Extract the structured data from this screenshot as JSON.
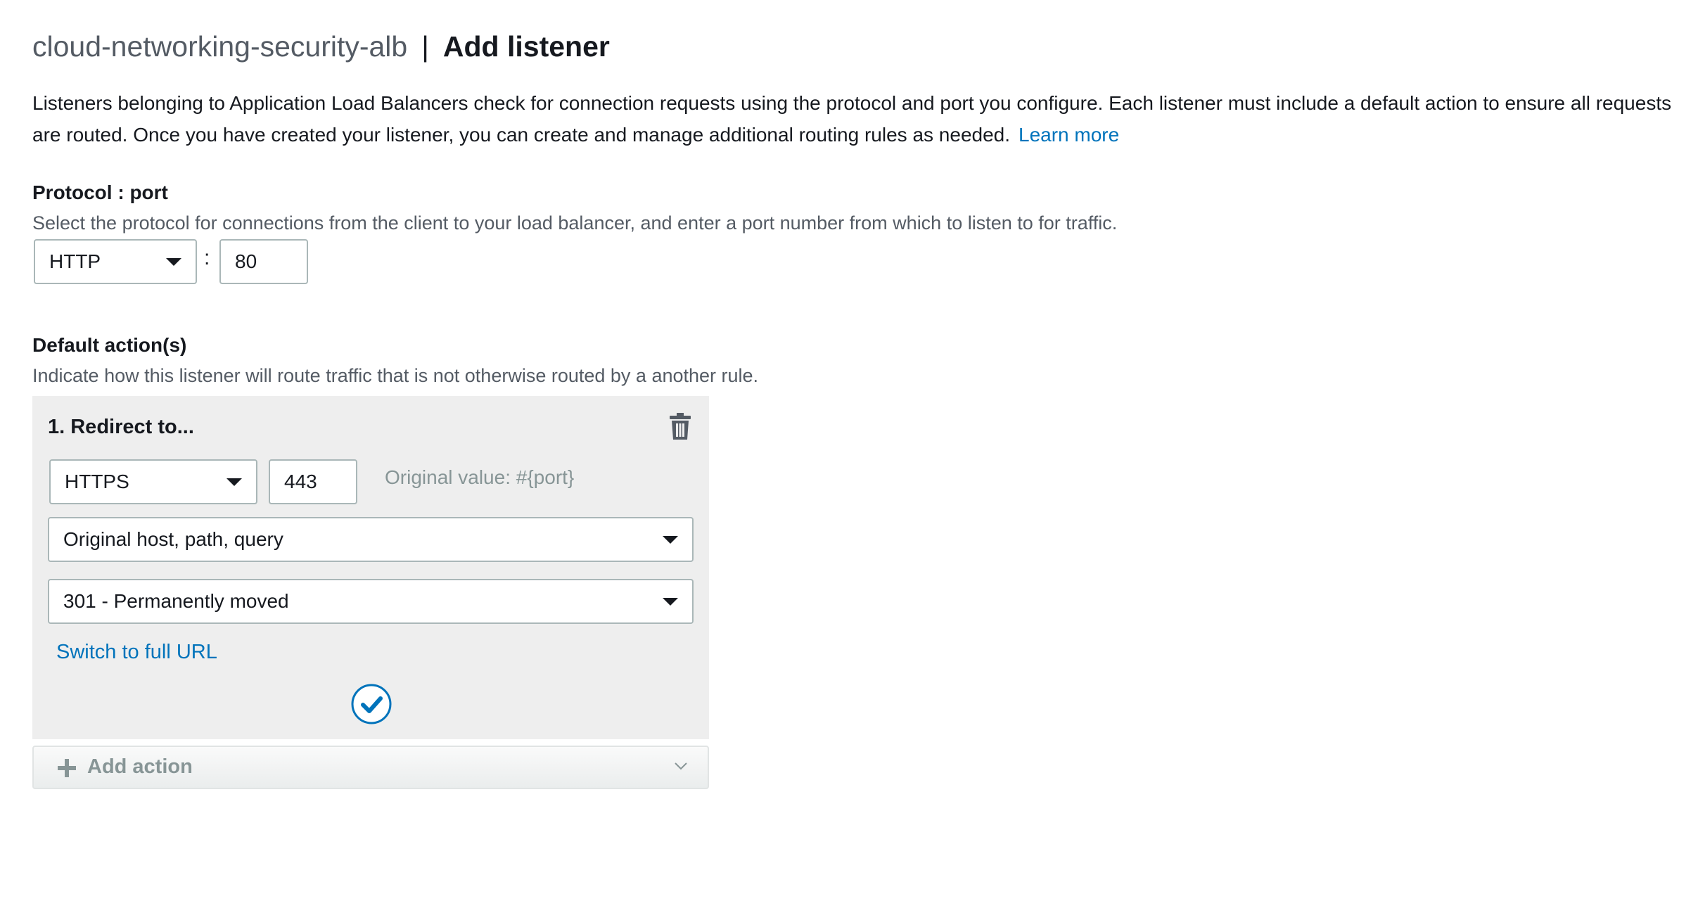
{
  "header": {
    "load_balancer_name": "cloud-networking-security-alb",
    "separator": "|",
    "title": "Add listener"
  },
  "intro": {
    "line1": "Listeners belonging to Application Load Balancers check for connection requests using the protocol and port you configure. Each listener must include a default action to ensure all requests",
    "line2": "are routed. Once you have created your listener, you can create and manage additional routing rules as needed.",
    "learn_more": "Learn more"
  },
  "protocol_port": {
    "label": "Protocol : port",
    "description": "Select the protocol for connections from the client to your load balancer, and enter a port number from which to listen to for traffic.",
    "protocol_value": "HTTP",
    "colon": ":",
    "port_value": "80"
  },
  "default_actions": {
    "label": "Default action(s)",
    "description": "Indicate how this listener will route traffic that is not otherwise routed by a another rule.",
    "action": {
      "title": "1. Redirect to...",
      "protocol_value": "HTTPS",
      "port_value": "443",
      "original_value_hint": "Original value: #{port}",
      "target_value": "Original host, path, query",
      "status_code_value": "301 - Permanently moved",
      "switch_link": "Switch to full URL"
    },
    "add_action_label": "Add action"
  },
  "colors": {
    "link": "#0073bb",
    "panel_bg": "#eeeeee",
    "border": "#aab7b8",
    "muted": "#879596"
  },
  "icons": {
    "trash": "trash-icon",
    "confirm": "checkmark-circle-icon",
    "add": "plus-icon",
    "expand": "chevron-down-icon",
    "dropdown": "caret-down-icon"
  }
}
